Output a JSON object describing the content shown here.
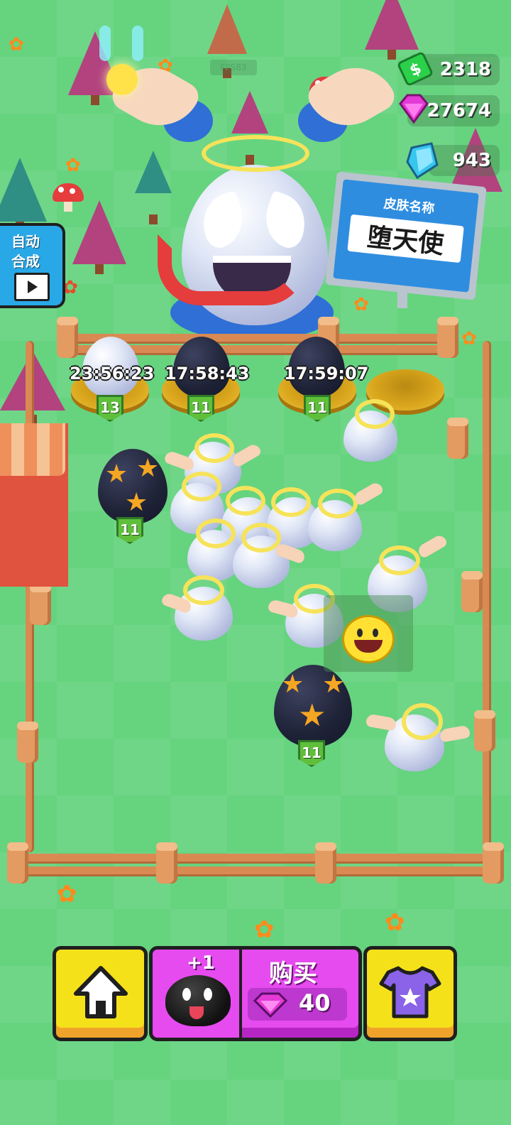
{
  "hud": {
    "fps": "FPS83",
    "cash": "2318",
    "gems": "27674",
    "diamonds": "943"
  },
  "auto_merge": {
    "line1": "自动",
    "line2": "合成"
  },
  "skin_sign": {
    "title": "皮肤名称",
    "name": "堕天使"
  },
  "nests": [
    {
      "timer": "23:56:23",
      "level": "13"
    },
    {
      "timer": "17:58:43",
      "level": "11"
    },
    {
      "timer": "17:59:07",
      "level": "11"
    }
  ],
  "field_eggs": [
    {
      "level": "11"
    },
    {
      "level": "11"
    }
  ],
  "bottom_bar": {
    "buy_label": "购买",
    "plus_one": "+1",
    "price": "40"
  },
  "colors": {
    "grass": "#66d37f",
    "fence": "#d98a52",
    "yellow_button": "#f5e11a",
    "buy_button": "#e64bef",
    "auto_button": "#29a8e8",
    "sign_blue": "#2f8de0"
  },
  "icons": {
    "home": "home-icon",
    "shirt": "tshirt-icon",
    "video": "video-ad-icon",
    "smiley": "smiley-emote-icon"
  }
}
